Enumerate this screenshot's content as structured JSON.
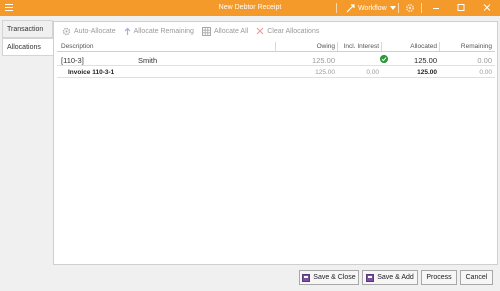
{
  "window": {
    "title": "New Debtor Receipt",
    "workflow_label": "Workflow",
    "accent_color": "#f39a2b"
  },
  "tabs": [
    {
      "label": "Transaction"
    },
    {
      "label": "Allocations"
    }
  ],
  "toolbar": {
    "auto_allocate": "Auto-Allocate",
    "allocate_remaining": "Allocate Remaining",
    "allocate_all": "Allocate All",
    "clear_allocations": "Clear Allocations"
  },
  "grid": {
    "headers": {
      "description": "Description",
      "owing": "Owing",
      "incl_interest": "Incl. Interest",
      "allocated": "Allocated",
      "remaining": "Remaining"
    },
    "parent_row": {
      "code": "[110-3]",
      "name": "Smith",
      "owing": "125.00",
      "incl_interest": "",
      "allocated": "125.00",
      "remaining": "0.00",
      "status_icon": "check-circle-icon"
    },
    "child_row": {
      "description": "Invoice 110-3-1",
      "owing": "125.00",
      "incl_interest": "0.00",
      "allocated": "125.00",
      "remaining": "0.00"
    }
  },
  "footer": {
    "save_close": "Save & Close",
    "save_add": "Save & Add",
    "process": "Process",
    "cancel": "Cancel"
  }
}
